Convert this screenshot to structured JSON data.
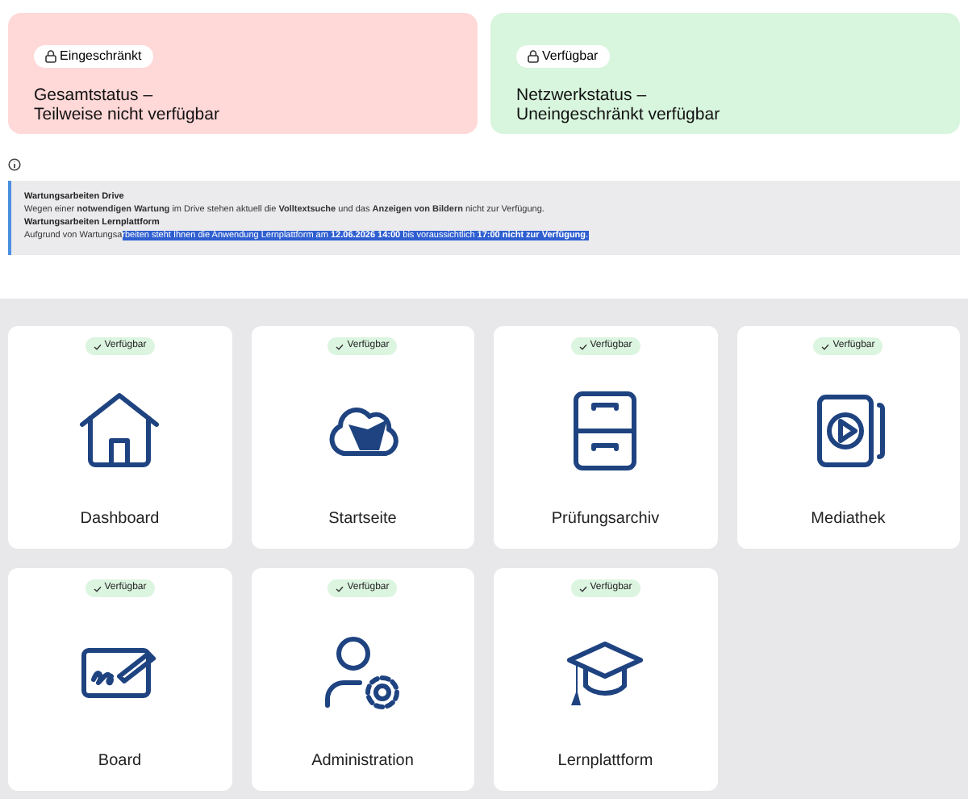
{
  "status_cards": [
    {
      "kind": "restricted",
      "badge": "Eingeschränkt",
      "title": "Gesamtstatus –",
      "subtitle": "Teilweise nicht verfügbar"
    },
    {
      "kind": "available",
      "badge": "Verfügbar",
      "title": "Netzwerkstatus –",
      "subtitle": "Uneingeschränkt verfügbar"
    }
  ],
  "notice": {
    "sections": [
      {
        "title": "Wartungsarbeiten Drive",
        "text": "Wegen einer **notwendigen Wartung** im Drive stehen aktuell die **Volltextsuche** und das **Anzeigen von Bildern** nicht zur Verfügung."
      },
      {
        "title": "Wartungsarbeiten Lernplattform",
        "text": "Aufgrund von Wartungsa",
        "highlighted_text": "rbeiten steht Ihnen die Anwendung Lernplattform am **12.06.2026 14:00** bis voraussichtlich **17:00 nicht zur Verfügung**."
      }
    ]
  },
  "tiles": [
    {
      "label": "Dashboard",
      "kind": "available",
      "badge": "Verfügbar"
    },
    {
      "label": "Startseite",
      "kind": "available",
      "badge": "Verfügbar"
    },
    {
      "label": "Prüfungsarchiv",
      "kind": "available",
      "badge": "Verfügbar"
    },
    {
      "label": "Mediathek",
      "kind": "available",
      "badge": "Verfügbar"
    },
    {
      "label": "Board",
      "kind": "available",
      "badge": "Verfügbar"
    },
    {
      "label": "Administration",
      "kind": "available",
      "badge": "Verfügbar"
    },
    {
      "label": "Lernplattform",
      "kind": "available",
      "badge": "Verfügbar"
    }
  ]
}
